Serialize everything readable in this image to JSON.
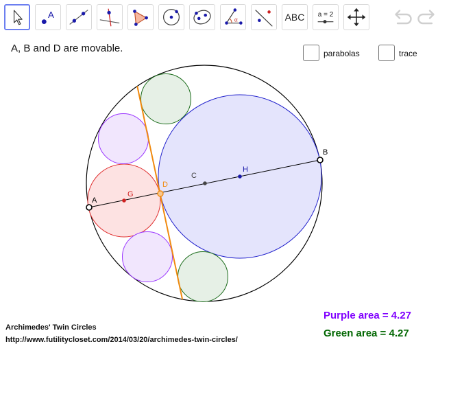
{
  "toolbar": {
    "tools": [
      {
        "name": "move",
        "icon": "cursor-arrow-icon"
      },
      {
        "name": "point",
        "icon": "point-icon",
        "glyph": "A"
      },
      {
        "name": "line",
        "icon": "line-icon"
      },
      {
        "name": "perpendicular",
        "icon": "perpendicular-line-icon"
      },
      {
        "name": "polygon",
        "icon": "polygon-icon"
      },
      {
        "name": "circle",
        "icon": "circle-center-point-icon"
      },
      {
        "name": "ellipse",
        "icon": "ellipse-icon"
      },
      {
        "name": "angle",
        "icon": "angle-icon",
        "glyph": "α"
      },
      {
        "name": "reflect",
        "icon": "reflect-icon"
      },
      {
        "name": "text",
        "icon": "text-icon",
        "label": "ABC"
      },
      {
        "name": "slider",
        "icon": "slider-icon",
        "label": "a = 2"
      },
      {
        "name": "move-graphics",
        "icon": "move-graphics-icon"
      }
    ],
    "undo_icon": "undo-icon",
    "redo_icon": "redo-icon"
  },
  "instruction": "A, B and D are movable.",
  "checkboxes": [
    {
      "label": "parabolas",
      "checked": false
    },
    {
      "label": "trace",
      "checked": false
    }
  ],
  "figure": {
    "point_labels": {
      "A": "A",
      "B": "B",
      "C": "C",
      "D": "D",
      "G": "G",
      "H": "H"
    },
    "colors": {
      "outer_circle": "#000000",
      "left_circle_stroke": "#e03030",
      "left_circle_fill": "#fde2e2",
      "right_circle_stroke": "#2020cc",
      "right_circle_fill": "#e4e4fc",
      "purple_stroke": "#9933ff",
      "purple_fill": "#f1e6fd",
      "green_stroke": "#1a6b1a",
      "green_fill": "#e6f0e6",
      "tangent_line": "#f08a10",
      "point_G": "#d02020",
      "point_H": "#1a1aaa",
      "point_D": "#f08a10"
    }
  },
  "credits": {
    "title": "Archimedes' Twin Circles",
    "url": "http://www.futilitycloset.com/2014/03/20/archimedes-twin-circles/"
  },
  "areas": {
    "purple": "Purple area = 4.27",
    "green": "Green area = 4.27",
    "purple_color": "#8000ff",
    "green_color": "#006600"
  }
}
